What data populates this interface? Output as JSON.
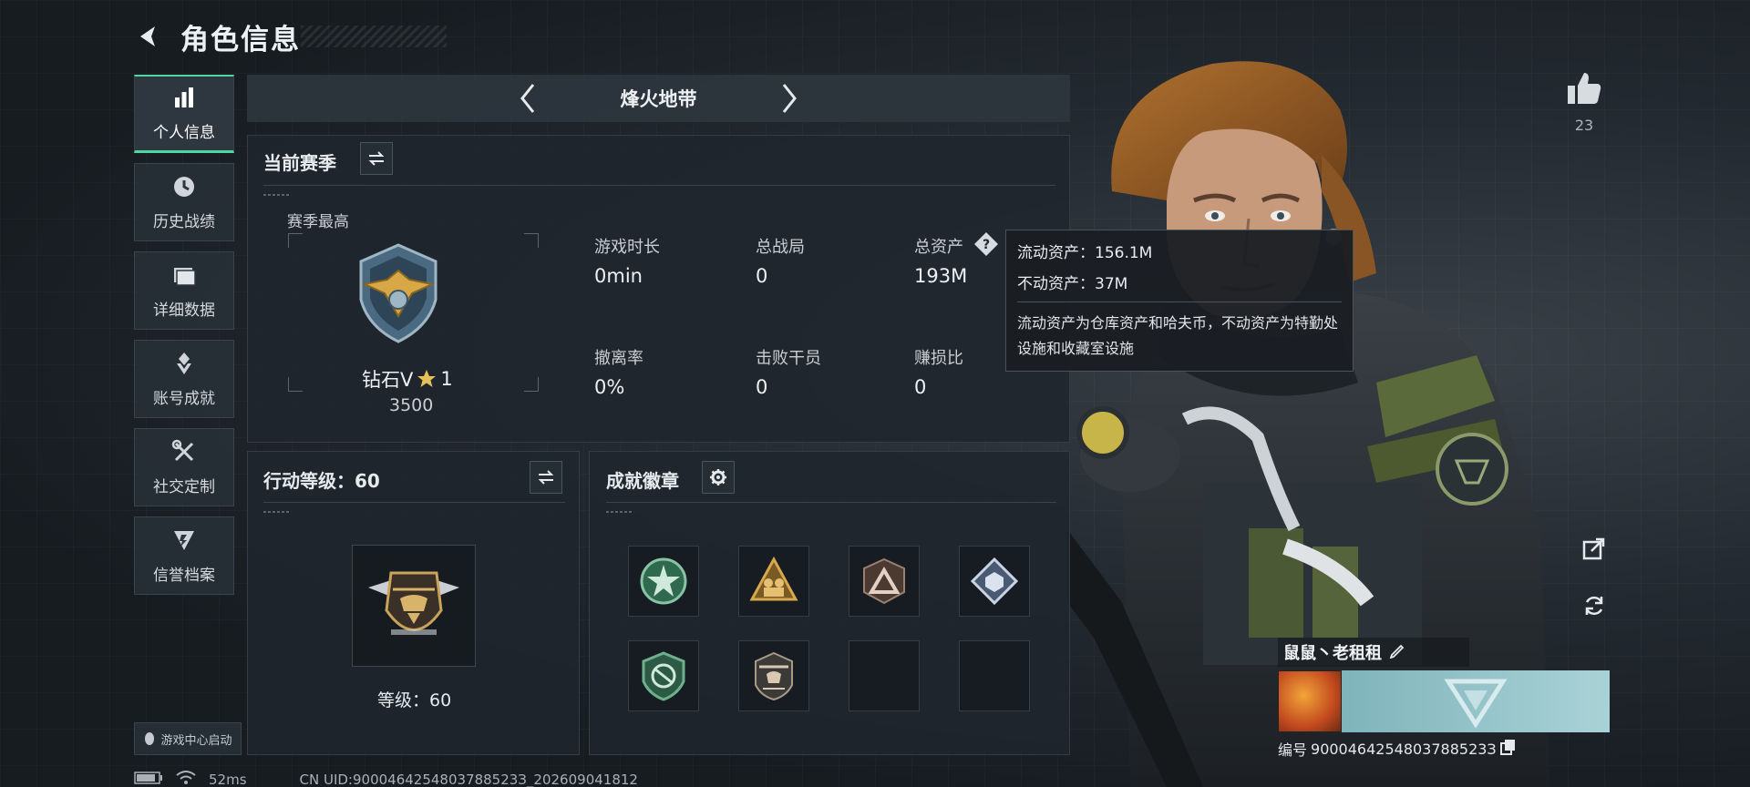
{
  "header": {
    "title": "角色信息"
  },
  "sidebar": {
    "items": [
      {
        "label": "个人信息",
        "icon": "bar-chart-icon",
        "active": true
      },
      {
        "label": "历史战绩",
        "icon": "clock-icon"
      },
      {
        "label": "详细数据",
        "icon": "folder-icon"
      },
      {
        "label": "账号成就",
        "icon": "achievement-icon"
      },
      {
        "label": "社交定制",
        "icon": "wrench-icon"
      },
      {
        "label": "信誉档案",
        "icon": "shield-icon"
      }
    ],
    "game_center_label": "游戏中心启动"
  },
  "mode_bar": {
    "name": "烽火地带"
  },
  "season_panel": {
    "title": "当前赛季",
    "highest_label": "赛季最高",
    "rank_name": "钻石V",
    "rank_stars": "1",
    "rank_score": "3500",
    "stats": [
      {
        "label": "游戏时长",
        "value": "0min"
      },
      {
        "label": "总战局",
        "value": "0"
      },
      {
        "label": "总资产",
        "value": "193M"
      },
      {
        "label": "撤离率",
        "value": "0%"
      },
      {
        "label": "击败干员",
        "value": "0"
      },
      {
        "label": "赚损比",
        "value": "0"
      }
    ]
  },
  "tooltip": {
    "liquid_label": "流动资产：",
    "liquid_value": "156.1M",
    "fixed_label": "不动资产：",
    "fixed_value": "37M",
    "note": "流动资产为仓库资产和哈夫币，不动资产为特勤处设施和收藏室设施"
  },
  "action_panel": {
    "title": "行动等级：60",
    "level_text": "等级：60"
  },
  "badges_panel": {
    "title": "成就徽章",
    "slots": [
      {
        "icon": "green-star-badge-icon"
      },
      {
        "icon": "gold-soldiers-badge-icon"
      },
      {
        "icon": "triangle-badge-icon"
      },
      {
        "icon": "cube-badge-icon"
      },
      {
        "icon": "green-arrows-badge-icon"
      },
      {
        "icon": "helicopter-badge-icon"
      },
      {
        "icon": ""
      },
      {
        "icon": ""
      }
    ]
  },
  "likes": {
    "count": "23"
  },
  "player": {
    "name": "鼠鼠丶老租租",
    "id_label": "编号",
    "id": "9000464254803788523З"
  },
  "status": {
    "ping": "52ms",
    "uid": "CN UID:9000464254803788523З_202609041812"
  },
  "colors": {
    "accent": "#4fd6a2",
    "panel_bg": "#1f262d",
    "emblem": "#8fc2c7"
  }
}
